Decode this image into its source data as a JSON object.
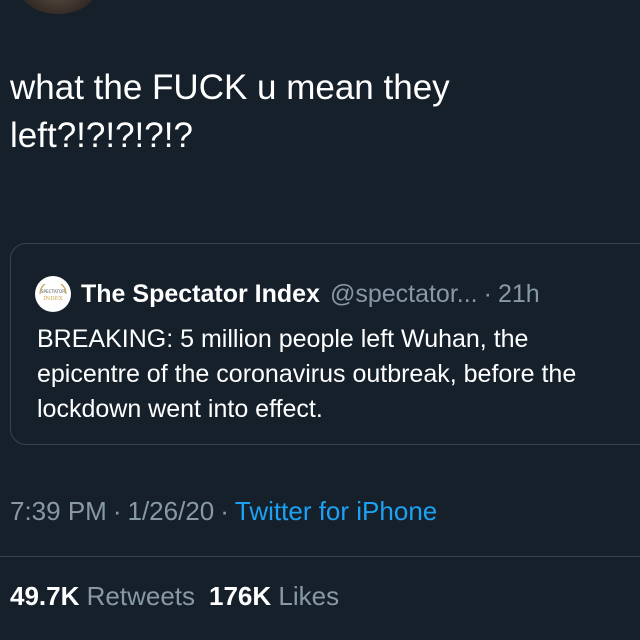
{
  "tweet": {
    "text": "what the FUCK u mean they left?!?!?!?!?"
  },
  "quoted_tweet": {
    "logo_text_top": "SPECTATOR",
    "logo_text_bottom": "INDEX",
    "name": "The Spectator Index",
    "handle": "@spectator...",
    "separator": "·",
    "time": "21h",
    "body": "BREAKING: 5 million people left Wuhan, the epicentre of the coronavirus outbreak, before the lockdown went into effect."
  },
  "meta": {
    "time": "7:39 PM",
    "separator": "·",
    "date": "1/26/20",
    "source": "Twitter for iPhone"
  },
  "stats": {
    "retweets_count": "49.7K",
    "retweets_label": "Retweets",
    "likes_count": "176K",
    "likes_label": "Likes"
  },
  "colors": {
    "background": "#15202b",
    "text_primary": "#ffffff",
    "text_secondary": "#8899a6",
    "link": "#1da1f2",
    "border": "#38444d"
  },
  "icons": {
    "author_avatar": "avatar",
    "quoted_logo": "spectator-index-logo"
  }
}
